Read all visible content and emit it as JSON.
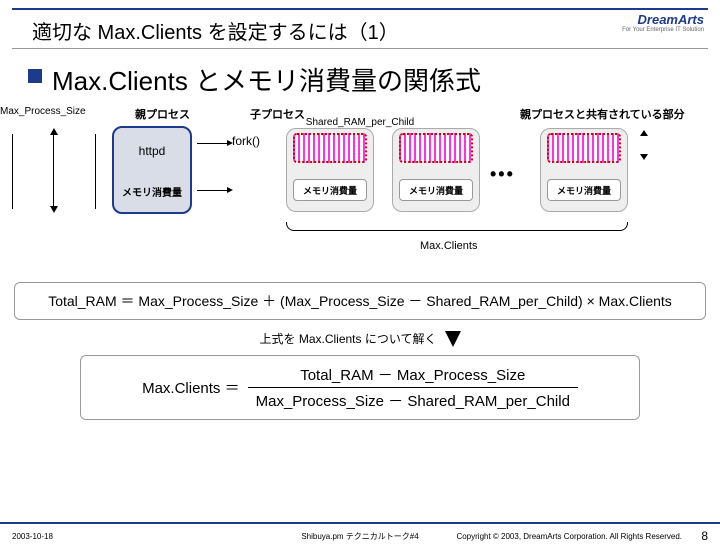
{
  "branding": {
    "logo": "DreamArts",
    "tagline": "For Your Enterprise IT Solution"
  },
  "slide": {
    "title": "適切な Max.Clients を設定するには（1）",
    "heading": "Max.Clients とメモリ消費量の関係式",
    "page_number": "8"
  },
  "diagram": {
    "parent_label": "親プロセス",
    "child_label": "子プロセス",
    "shared_label": "親プロセスと共有されている部分",
    "max_process_size": "Max_Process_Size",
    "shared_ram_per_child": "Shared_RAM_per_Child",
    "httpd": "httpd",
    "fork": "fork()",
    "mem_usage": "メモリ消費量",
    "dots": "•••",
    "brace_label": "Max.Clients"
  },
  "formula": {
    "total": "Total_RAM ＝ Max_Process_Size ＋ (Max_Process_Size － Shared_RAM_per_Child) × Max.Clients",
    "solve_text": "上式を Max.Clients について解く",
    "result_lhs": "Max.Clients ＝",
    "numerator": "Total_RAM － Max_Process_Size",
    "denominator": "Max_Process_Size － Shared_RAM_per_Child"
  },
  "footer": {
    "date": "2003-10-18",
    "center": "Shibuya.pm テクニカルトーク#4",
    "copyright": "Copyright © 2003, DreamArts Corporation. All Rights Reserved."
  }
}
